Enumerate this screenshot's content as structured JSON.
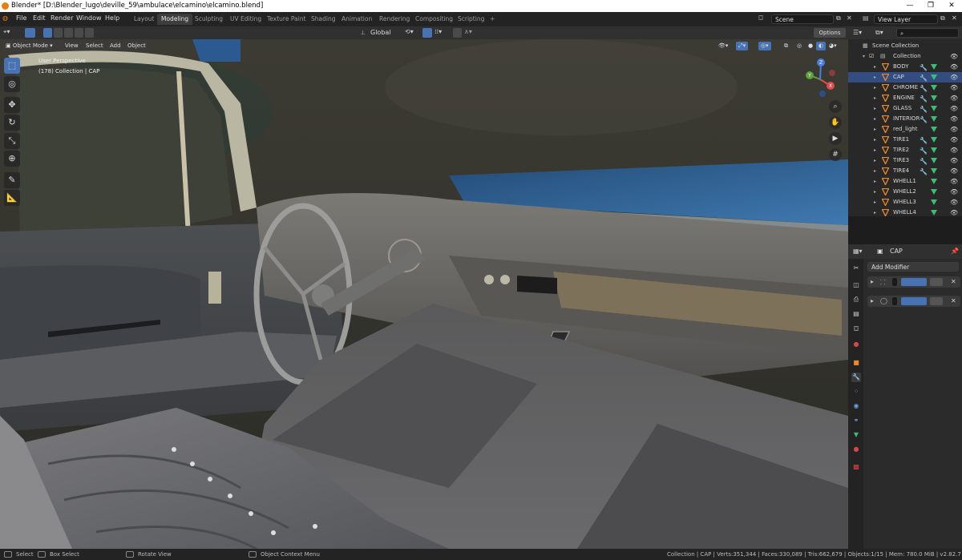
{
  "window": {
    "title": "Blender* [D:\\Blender_lugo\\deville_59\\ambulace\\elcamino\\elcamino.blend]",
    "minimize": "—",
    "maximize": "❐",
    "close": "✕"
  },
  "menu": [
    "File",
    "Edit",
    "Render",
    "Window",
    "Help"
  ],
  "workspaces": [
    "Layout",
    "Modeling",
    "Sculpting",
    "UV Editing",
    "Texture Paint",
    "Shading",
    "Animation",
    "Rendering",
    "Compositing",
    "Scripting",
    "+"
  ],
  "active_workspace": "Modeling",
  "scene_field": "Scene",
  "view_layer_field": "View Layer",
  "viewport_header": {
    "transform_orientation": "Global",
    "options": "Options"
  },
  "viewport": {
    "mode": "Object Mode",
    "menus": [
      "View",
      "Select",
      "Add",
      "Object"
    ],
    "perspective_label": "User Perspective",
    "collection_label": "(178) Collection | CAP",
    "gizmo_axes": [
      "X",
      "Y",
      "Z"
    ]
  },
  "outliner": {
    "scene_collection": "Scene Collection",
    "collection": "Collection",
    "objects": [
      {
        "name": "BODY",
        "modifier": true
      },
      {
        "name": "CAP",
        "modifier": true
      },
      {
        "name": "CHROME",
        "modifier": true
      },
      {
        "name": "ENGINE",
        "modifier": true
      },
      {
        "name": "GLASS",
        "modifier": true
      },
      {
        "name": "INTERIOR",
        "modifier": true
      },
      {
        "name": "red_light",
        "modifier": false
      },
      {
        "name": "TIRE1",
        "modifier": true
      },
      {
        "name": "TIRE2",
        "modifier": true
      },
      {
        "name": "TIRE3",
        "modifier": true
      },
      {
        "name": "TIRE4",
        "modifier": true
      },
      {
        "name": "WHELL1",
        "modifier": false
      },
      {
        "name": "WHELL2",
        "modifier": false
      },
      {
        "name": "WHELL3",
        "modifier": false
      },
      {
        "name": "WHELL4",
        "modifier": false
      }
    ],
    "selected": "CAP"
  },
  "properties": {
    "object_name": "CAP",
    "add_modifier": "Add Modifier"
  },
  "status_bar": {
    "select": "Select",
    "box_select": "Box Select",
    "rotate_view": "Rotate View",
    "context_menu": "Object Context Menu",
    "stats": "Collection | CAP | Verts:351,344 | Faces:330,089 | Tris:662,679 | Objects:1/15 | Mem: 780.0 MiB | v2.82.7"
  },
  "colors": {
    "accent": "#4772b3",
    "selected_row": "#334d80",
    "mesh_orange": "#e8892c",
    "modifier_green": "#3bbd72"
  }
}
